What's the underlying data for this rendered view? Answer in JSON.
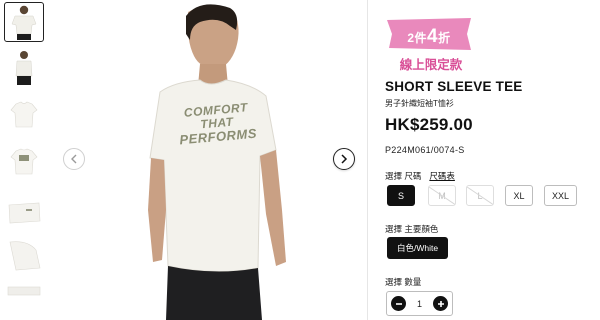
{
  "promo": {
    "deal_prefix": "2件",
    "deal_number": "4",
    "deal_suffix": "折",
    "online_only": "線上限定款",
    "tag_color": "#e989bc"
  },
  "product": {
    "title": "SHORT SLEEVE TEE",
    "subtitle": "男子針織短袖T恤衫",
    "price": "HK$259.00",
    "sku": "P224M061/0074-S",
    "shirt_print_lines": [
      "COMFORT",
      "THAT",
      "PERFORMS"
    ]
  },
  "size": {
    "label": "選擇 尺碼",
    "guide": "尺碼表",
    "options": [
      {
        "label": "S",
        "state": "selected"
      },
      {
        "label": "M",
        "state": "disabled"
      },
      {
        "label": "L",
        "state": "disabled"
      },
      {
        "label": "XL",
        "state": "available"
      },
      {
        "label": "XXL",
        "state": "available"
      }
    ]
  },
  "color": {
    "label": "選擇 主要顏色",
    "selected": "白色/White"
  },
  "quantity": {
    "label": "選擇 數量",
    "value": "1"
  },
  "gallery": {
    "thumbnails": [
      "model-front",
      "model-side",
      "shirt-front",
      "shirt-back",
      "shirt-folded",
      "shirt-detail",
      "shirt-closeup"
    ],
    "active_index": 0
  },
  "icons": {
    "prev": "chevron-left-icon",
    "next": "chevron-right-icon",
    "minus": "minus-icon",
    "plus": "plus-icon"
  }
}
